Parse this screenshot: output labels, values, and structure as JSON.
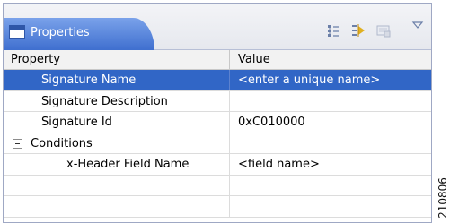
{
  "view": {
    "tab_title": "Properties",
    "toolbar": {
      "icons": [
        "show-categories-icon",
        "filter-icon",
        "restore-defaults-icon",
        "view-menu-icon"
      ]
    }
  },
  "table": {
    "columns": [
      "Property",
      "Value"
    ],
    "rows": [
      {
        "property": "Signature Name",
        "value": "<enter a unique name>",
        "selected": true
      },
      {
        "property": "Signature Description",
        "value": ""
      },
      {
        "property": "Signature Id",
        "value": "0xC010000"
      },
      {
        "property": "Conditions",
        "value": "",
        "expander": "collapse"
      },
      {
        "property": "x-Header Field Name",
        "value": "<field name>"
      },
      {
        "property": "",
        "value": ""
      },
      {
        "property": "",
        "value": ""
      }
    ]
  },
  "figure_id": "210806",
  "colors": {
    "tab_active": "#4a78d8",
    "selection": "#3166c6",
    "grid": "#dcdcdc"
  }
}
